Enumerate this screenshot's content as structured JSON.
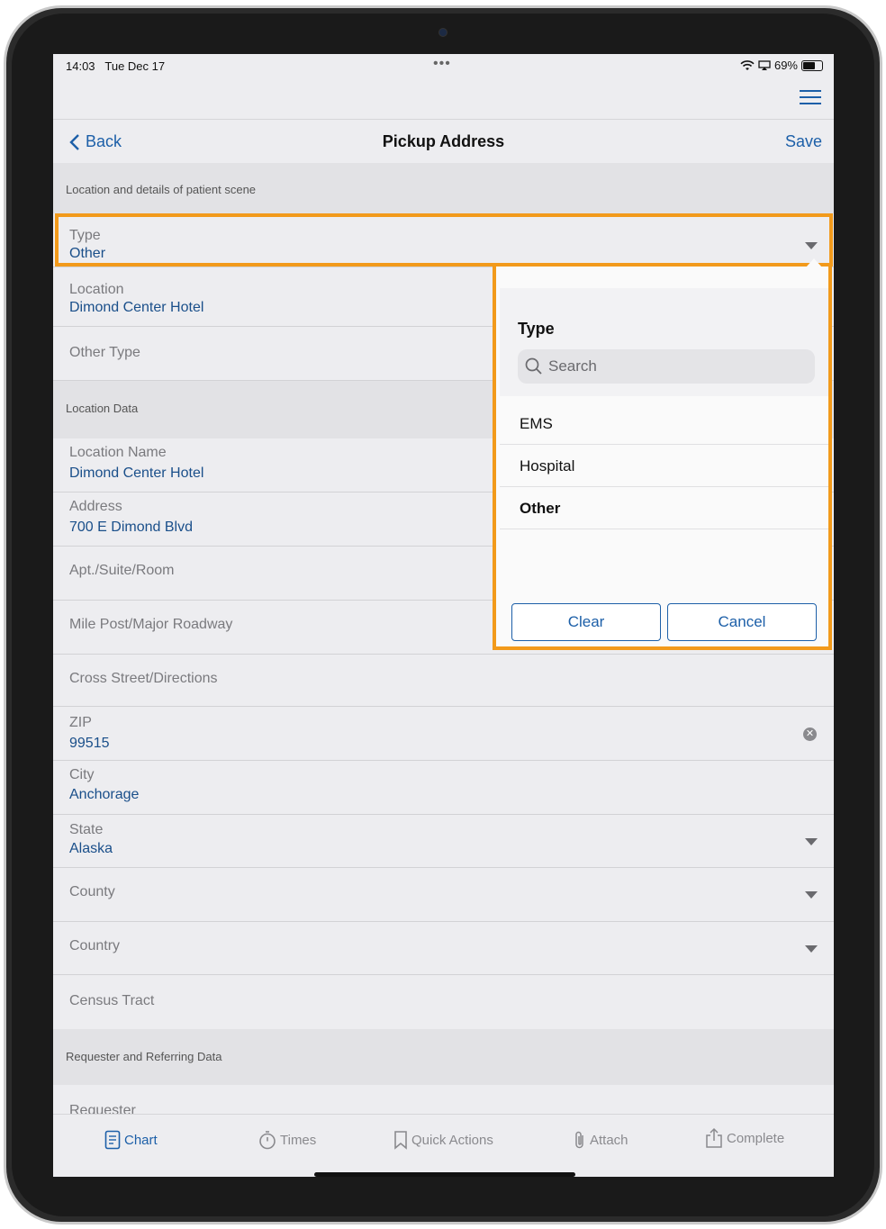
{
  "status": {
    "time": "14:03",
    "date": "Tue Dec 17",
    "battery": "69%"
  },
  "nav": {
    "back": "Back",
    "title": "Pickup Address",
    "save": "Save"
  },
  "sections": {
    "scene": "Location and details of patient scene",
    "location_data": "Location Data",
    "requester": "Requester and Referring Data"
  },
  "fields": {
    "type": {
      "label": "Type",
      "value": "Other"
    },
    "location": {
      "label": "Location",
      "value": "Dimond Center Hotel"
    },
    "other_type": {
      "label": "Other Type"
    },
    "location_name": {
      "label": "Location Name",
      "value": "Dimond Center Hotel"
    },
    "address": {
      "label": "Address",
      "value": "700 E Dimond Blvd"
    },
    "apt": {
      "label": "Apt./Suite/Room"
    },
    "mile_post": {
      "label": "Mile Post/Major Roadway"
    },
    "cross_street": {
      "label": "Cross Street/Directions"
    },
    "zip": {
      "label": "ZIP",
      "value": "99515"
    },
    "city": {
      "label": "City",
      "value": "Anchorage"
    },
    "state": {
      "label": "State",
      "value": "Alaska"
    },
    "county": {
      "label": "County"
    },
    "country": {
      "label": "Country"
    },
    "census": {
      "label": "Census Tract"
    },
    "requester": {
      "label": "Requester"
    }
  },
  "popover": {
    "title": "Type",
    "search_placeholder": "Search",
    "options": [
      "EMS",
      "Hospital",
      "Other"
    ],
    "selected": "Other",
    "clear": "Clear",
    "cancel": "Cancel"
  },
  "tabs": {
    "chart": "Chart",
    "times": "Times",
    "quick_actions": "Quick Actions",
    "attach": "Attach",
    "complete": "Complete"
  },
  "colors": {
    "accent": "#1c5fa8",
    "highlight": "#f29a1b"
  }
}
